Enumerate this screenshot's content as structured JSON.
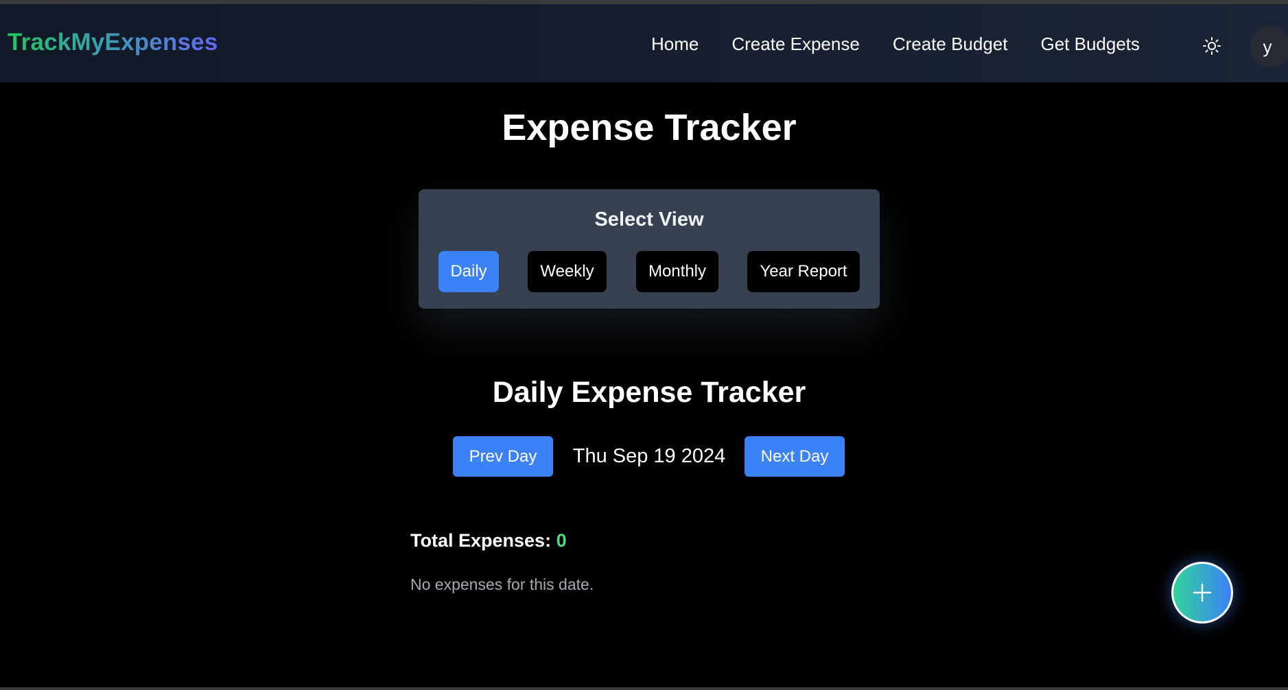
{
  "header": {
    "brand": "TrackMyExpenses",
    "nav": [
      "Home",
      "Create Expense",
      "Create Budget",
      "Get Budgets"
    ],
    "theme_icon": "sun-icon",
    "avatar_initial": "y"
  },
  "main": {
    "title": "Expense Tracker",
    "view_selector": {
      "title": "Select View",
      "options": [
        "Daily",
        "Weekly",
        "Monthly",
        "Year Report"
      ],
      "selected": "Daily"
    },
    "daily": {
      "title": "Daily Expense Tracker",
      "prev_label": "Prev Day",
      "date": "Thu Sep 19 2024",
      "next_label": "Next Day",
      "total_label": "Total Expenses:",
      "total_value": "0",
      "empty_message": "No expenses for this date."
    }
  },
  "fab": {
    "icon": "plus-icon"
  },
  "colors": {
    "accent": "#3b82f6",
    "card": "#374151",
    "total_value": "#4ade80",
    "brand_gradient": [
      "#22c55e",
      "#6366f1"
    ]
  }
}
